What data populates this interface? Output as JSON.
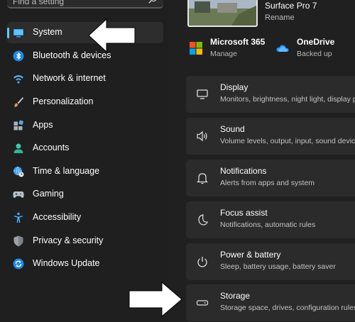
{
  "search": {
    "placeholder": "Find a setting"
  },
  "sidebar": {
    "items": [
      {
        "label": "System",
        "icon": "monitor-icon"
      },
      {
        "label": "Bluetooth & devices",
        "icon": "bluetooth-icon"
      },
      {
        "label": "Network & internet",
        "icon": "wifi-icon"
      },
      {
        "label": "Personalization",
        "icon": "brush-icon"
      },
      {
        "label": "Apps",
        "icon": "apps-icon"
      },
      {
        "label": "Accounts",
        "icon": "person-icon"
      },
      {
        "label": "Time & language",
        "icon": "globe-clock-icon"
      },
      {
        "label": "Gaming",
        "icon": "gamepad-icon"
      },
      {
        "label": "Accessibility",
        "icon": "accessibility-icon"
      },
      {
        "label": "Privacy & security",
        "icon": "shield-icon"
      },
      {
        "label": "Windows Update",
        "icon": "update-icon"
      }
    ],
    "selected": "System"
  },
  "device": {
    "name": "Surface Pro 7",
    "rename_label": "Rename"
  },
  "accounts": [
    {
      "title": "Microsoft 365",
      "subtitle": "Manage",
      "icon": "microsoft-365-icon"
    },
    {
      "title": "OneDrive",
      "subtitle": "Backed up",
      "icon": "onedrive-cloud-icon"
    }
  ],
  "cards": [
    {
      "title": "Display",
      "subtitle": "Monitors, brightness, night light, display profile",
      "icon": "display-icon"
    },
    {
      "title": "Sound",
      "subtitle": "Volume levels, output, input, sound devices",
      "icon": "speaker-icon"
    },
    {
      "title": "Notifications",
      "subtitle": "Alerts from apps and system",
      "icon": "bell-icon"
    },
    {
      "title": "Focus assist",
      "subtitle": "Notifications, automatic rules",
      "icon": "moon-icon"
    },
    {
      "title": "Power & battery",
      "subtitle": "Sleep, battery usage, battery saver",
      "icon": "power-icon"
    },
    {
      "title": "Storage",
      "subtitle": "Storage space, drives, configuration rules",
      "icon": "storage-icon"
    }
  ],
  "colors": {
    "accent": "#60cdff",
    "background": "#202020",
    "card": "#2b2b2b",
    "selected_item": "#2d2d2d"
  }
}
